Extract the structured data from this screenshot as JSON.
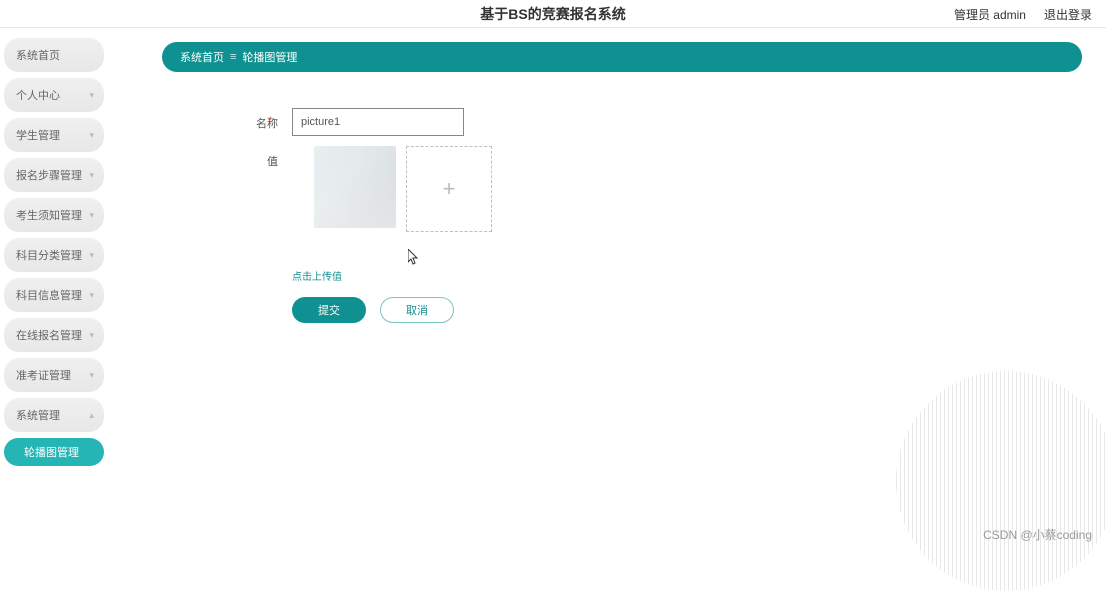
{
  "header": {
    "title": "基于BS的竞赛报名系统",
    "admin_label": "管理员 admin",
    "logout_label": "退出登录"
  },
  "sidebar": {
    "items": [
      {
        "label": "系统首页",
        "expandable": false
      },
      {
        "label": "个人中心",
        "expandable": true
      },
      {
        "label": "学生管理",
        "expandable": true
      },
      {
        "label": "报名步骤管理",
        "expandable": true
      },
      {
        "label": "考生须知管理",
        "expandable": true
      },
      {
        "label": "科目分类管理",
        "expandable": true
      },
      {
        "label": "科目信息管理",
        "expandable": true
      },
      {
        "label": "在线报名管理",
        "expandable": true
      },
      {
        "label": "准考证管理",
        "expandable": true
      },
      {
        "label": "系统管理",
        "expandable": true,
        "active": true
      }
    ],
    "subitem": {
      "label": "轮播图管理"
    }
  },
  "breadcrumb": {
    "home": "系统首页",
    "current": "轮播图管理"
  },
  "form": {
    "name_label": "名称",
    "name_value": "picture1",
    "value_label": "值",
    "upload_link": "点击上传值",
    "submit_label": "提交",
    "cancel_label": "取消"
  },
  "watermark": "CSDN @小蔡coding",
  "colors": {
    "primary": "#109191",
    "accent": "#26b5b5",
    "pill": "#e7e7e7"
  }
}
